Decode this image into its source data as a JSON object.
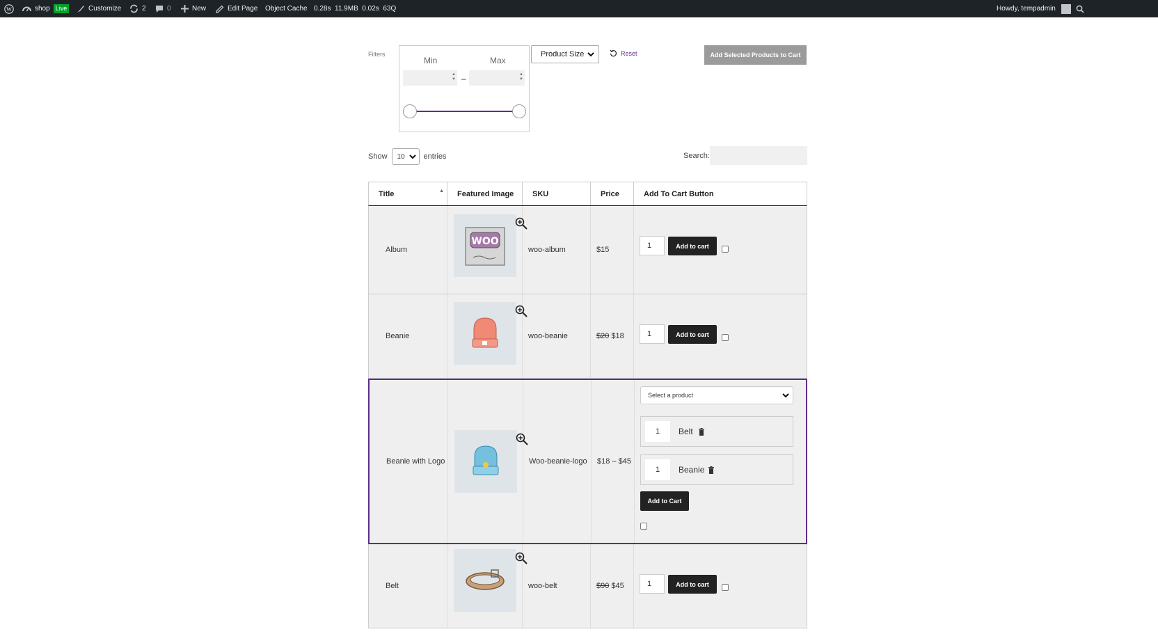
{
  "admin_bar": {
    "site_name": "shop",
    "live_badge": "Live",
    "customize": "Customize",
    "updates_count": "2",
    "comments_count": "0",
    "new_label": "New",
    "edit_page": "Edit Page",
    "object_cache": "Object Cache",
    "stats": "0.28s  11.9MB  0.02s  63Q",
    "howdy": "Howdy, tempadmin"
  },
  "filters": {
    "label": "Filters",
    "min_label": "Min",
    "max_label": "Max",
    "range_dash": "–",
    "size_select": "Product Size",
    "reset": "Reset",
    "add_selected": "Add Selected Products to Cart"
  },
  "table_controls": {
    "show": "Show",
    "entries_value": "10",
    "entries": "entries",
    "search_label": "Search:"
  },
  "table": {
    "headers": [
      "Title",
      "Featured Image",
      "SKU",
      "Price",
      "Add To Cart Button"
    ],
    "add_to_cart": "Add to cart",
    "rows": [
      {
        "title": "Album",
        "sku": "woo-album",
        "price_old": "",
        "price": "$15",
        "qty": "1",
        "image": "album-image"
      },
      {
        "title": "Beanie",
        "sku": "woo-beanie",
        "price_old": "$20",
        "price": "$18",
        "qty": "1",
        "image": "beanie-image"
      },
      {
        "title": "Beanie with Logo",
        "sku": "Woo-beanie-logo",
        "price_old": "",
        "price": "$18 – $45",
        "image": "beanie-logo-image",
        "select_placeholder": "Select a product",
        "bundle_items": [
          {
            "qty": "1",
            "name": "Belt"
          },
          {
            "qty": "1",
            "name": "Beanie"
          }
        ],
        "add_button": "Add to Cart"
      },
      {
        "title": "Belt",
        "sku": "woo-belt",
        "price_old": "$90",
        "price": "$45",
        "qty": "1",
        "image": "belt-image"
      }
    ]
  },
  "colors": {
    "admin_bar_bg": "#1d2327",
    "accent_purple": "#5d2d8e",
    "button_dark": "#222222",
    "button_disabled": "#9b9b9b"
  }
}
